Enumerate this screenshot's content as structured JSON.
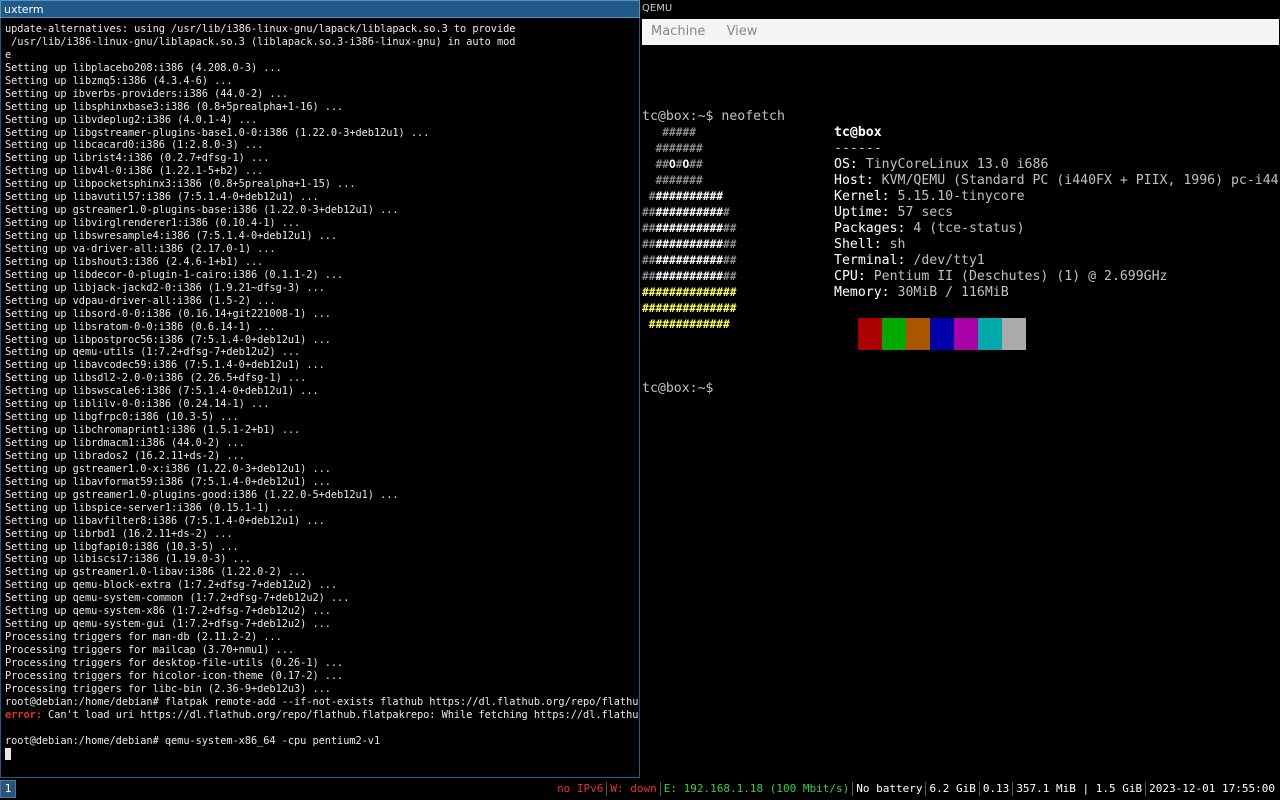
{
  "xterm": {
    "title": "uxterm",
    "lines": [
      "update-alternatives: using /usr/lib/i386-linux-gnu/lapack/liblapack.so.3 to provide",
      " /usr/lib/i386-linux-gnu/liblapack.so.3 (liblapack.so.3-i386-linux-gnu) in auto mod",
      "e",
      "Setting up libplacebo208:i386 (4.208.0-3) ...",
      "Setting up libzmq5:i386 (4.3.4-6) ...",
      "Setting up ibverbs-providers:i386 (44.0-2) ...",
      "Setting up libsphinxbase3:i386 (0.8+5prealpha+1-16) ...",
      "Setting up libvdeplug2:i386 (4.0.1-4) ...",
      "Setting up libgstreamer-plugins-base1.0-0:i386 (1.22.0-3+deb12u1) ...",
      "Setting up libcacard0:i386 (1:2.8.0-3) ...",
      "Setting up librist4:i386 (0.2.7+dfsg-1) ...",
      "Setting up libv4l-0:i386 (1.22.1-5+b2) ...",
      "Setting up libpocketsphinx3:i386 (0.8+5prealpha+1-15) ...",
      "Setting up libavutil57:i386 (7:5.1.4-0+deb12u1) ...",
      "Setting up gstreamer1.0-plugins-base:i386 (1.22.0-3+deb12u1) ...",
      "Setting up libvirglrenderer1:i386 (0.10.4-1) ...",
      "Setting up libswresample4:i386 (7:5.1.4-0+deb12u1) ...",
      "Setting up va-driver-all:i386 (2.17.0-1) ...",
      "Setting up libshout3:i386 (2.4.6-1+b1) ...",
      "Setting up libdecor-0-plugin-1-cairo:i386 (0.1.1-2) ...",
      "Setting up libjack-jackd2-0:i386 (1.9.21~dfsg-3) ...",
      "Setting up vdpau-driver-all:i386 (1.5-2) ...",
      "Setting up libsord-0-0:i386 (0.16.14+git221008-1) ...",
      "Setting up libsratom-0-0:i386 (0.6.14-1) ...",
      "Setting up libpostproc56:i386 (7:5.1.4-0+deb12u1) ...",
      "Setting up qemu-utils (1:7.2+dfsg-7+deb12u2) ...",
      "Setting up libavcodec59:i386 (7:5.1.4-0+deb12u1) ...",
      "Setting up libsdl2-2.0-0:i386 (2.26.5+dfsg-1) ...",
      "Setting up libswscale6:i386 (7:5.1.4-0+deb12u1) ...",
      "Setting up liblilv-0-0:i386 (0.24.14-1) ...",
      "Setting up libgfrpc0:i386 (10.3-5) ...",
      "Setting up libchromaprint1:i386 (1.5.1-2+b1) ...",
      "Setting up librdmacm1:i386 (44.0-2) ...",
      "Setting up librados2 (16.2.11+ds-2) ...",
      "Setting up gstreamer1.0-x:i386 (1.22.0-3+deb12u1) ...",
      "Setting up libavformat59:i386 (7:5.1.4-0+deb12u1) ...",
      "Setting up gstreamer1.0-plugins-good:i386 (1.22.0-5+deb12u1) ...",
      "Setting up libspice-server1:i386 (0.15.1-1) ...",
      "Setting up libavfilter8:i386 (7:5.1.4-0+deb12u1) ...",
      "Setting up librbd1 (16.2.11+ds-2) ...",
      "Setting up libgfapi0:i386 (10.3-5) ...",
      "Setting up libiscsi7:i386 (1.19.0-3) ...",
      "Setting up gstreamer1.0-libav:i386 (1.22.0-2) ...",
      "Setting up qemu-block-extra (1:7.2+dfsg-7+deb12u2) ...",
      "Setting up qemu-system-common (1:7.2+dfsg-7+deb12u2) ...",
      "Setting up qemu-system-x86 (1:7.2+dfsg-7+deb12u2) ...",
      "Setting up qemu-system-gui (1:7.2+dfsg-7+deb12u2) ...",
      "Processing triggers for man-db (2.11.2-2) ...",
      "Processing triggers for mailcap (3.70+nmu1) ...",
      "Processing triggers for desktop-file-utils (0.26-1) ...",
      "Processing triggers for hicolor-icon-theme (0.17-2) ...",
      "Processing triggers for libc-bin (2.36-9+deb12u3) ...",
      "root@debian:/home/debian# flatpak remote-add --if-not-exists flathub https://dl.flathub.org/repo/flathub."
    ],
    "error_label": "error:",
    "error_text": " Can't load uri https://dl.flathub.org/repo/flathub.flatpakrepo: While fetching https://dl.flathub.",
    "blank_line": "",
    "last_command": "root@debian:/home/debian# qemu-system-x86_64 -cpu pentium2-v1"
  },
  "qemu": {
    "title": "QEMU",
    "menu": [
      "Machine",
      "View"
    ],
    "prompt_line": "tc@box:~$ neofetch",
    "prompt_line2": "tc@box:~$",
    "logo": [
      "   #####      ",
      "  #######     ",
      "  ##O#O##     ",
      "  #######     ",
      " ###########  ",
      "############# ",
      "##############",
      "##############",
      "##############",
      "##############",
      "##############",
      "##############",
      " ############ "
    ],
    "info_title": "tc@box",
    "info_sep": "------",
    "info": [
      {
        "key": "OS:",
        "value": " TinyCoreLinux 13.0 i686"
      },
      {
        "key": "Host:",
        "value": " KVM/QEMU (Standard PC (i440FX + PIIX, 1996) pc-i44"
      },
      {
        "key": "Kernel:",
        "value": " 5.15.10-tinycore"
      },
      {
        "key": "Uptime:",
        "value": " 57 secs"
      },
      {
        "key": "Packages:",
        "value": " 4 (tce-status)"
      },
      {
        "key": "Shell:",
        "value": " sh"
      },
      {
        "key": "Terminal:",
        "value": " /dev/tty1"
      },
      {
        "key": "CPU:",
        "value": " Pentium II (Deschutes) (1) @ 2.699GHz"
      },
      {
        "key": "Memory:",
        "value": " 30MiB / 116MiB"
      }
    ],
    "palette": [
      "#aa0000",
      "#00aa00",
      "#aa5500",
      "#0000aa",
      "#aa00aa",
      "#00aaaa",
      "#aaaaaa"
    ]
  },
  "statusbar": {
    "workspace": "1",
    "items": [
      {
        "text": "no IPv6",
        "color": "#e5332a"
      },
      {
        "text": "W: down",
        "color": "#e5332a"
      },
      {
        "text": "E: 192.168.1.18 (100 Mbit/s)",
        "color": "#3bd13b"
      },
      {
        "text": "No battery",
        "color": "#ffffff"
      },
      {
        "text": "6.2 GiB",
        "color": "#ffffff"
      },
      {
        "text": "0.13",
        "color": "#ffffff"
      },
      {
        "text": "357.1 MiB | 1.5 GiB",
        "color": "#ffffff"
      },
      {
        "text": "2023-12-01 17:55:00",
        "color": "#ffffff"
      }
    ]
  }
}
